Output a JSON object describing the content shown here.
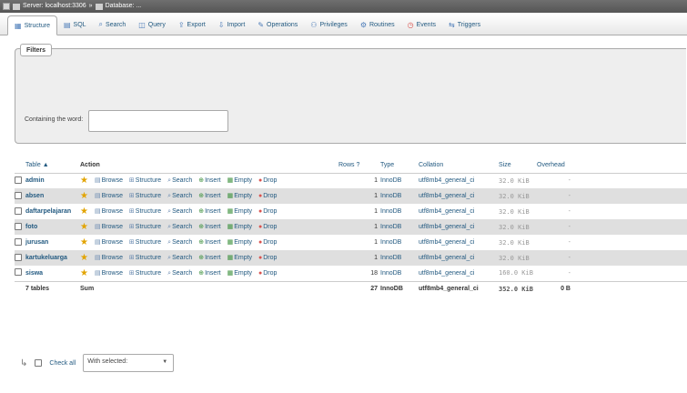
{
  "breadcrumb": {
    "server": "Server: localhost:3306",
    "database": "Database: ..."
  },
  "tabs": [
    {
      "label": "Structure",
      "icon": "structure-icon",
      "active": true
    },
    {
      "label": "SQL",
      "icon": "sql-icon"
    },
    {
      "label": "Search",
      "icon": "search-icon"
    },
    {
      "label": "Query",
      "icon": "query-icon"
    },
    {
      "label": "Export",
      "icon": "export-icon"
    },
    {
      "label": "Import",
      "icon": "import-icon"
    },
    {
      "label": "Operations",
      "icon": "wrench-icon"
    },
    {
      "label": "Privileges",
      "icon": "privileges-icon"
    },
    {
      "label": "Routines",
      "icon": "routines-icon"
    },
    {
      "label": "Events",
      "icon": "events-icon"
    },
    {
      "label": "Triggers",
      "icon": "triggers-icon"
    }
  ],
  "filters": {
    "legend": "Filters",
    "contains_label": "Containing the word:",
    "contains_value": ""
  },
  "table": {
    "headers": {
      "table": "Table",
      "action": "Action",
      "rows": "Rows",
      "type": "Type",
      "collation": "Collation",
      "size": "Size",
      "overhead": "Overhead"
    },
    "actions": [
      "Browse",
      "Structure",
      "Search",
      "Insert",
      "Empty",
      "Drop"
    ],
    "rows": [
      {
        "name": "admin",
        "rows": "1",
        "type": "InnoDB",
        "collation": "utf8mb4_general_ci",
        "size": "32.0 KiB",
        "overhead": "-"
      },
      {
        "name": "absen",
        "rows": "1",
        "type": "InnoDB",
        "collation": "utf8mb4_general_ci",
        "size": "32.0 KiB",
        "overhead": "-"
      },
      {
        "name": "daftarpelajaran",
        "rows": "1",
        "type": "InnoDB",
        "collation": "utf8mb4_general_ci",
        "size": "32.0 KiB",
        "overhead": "-"
      },
      {
        "name": "foto",
        "rows": "1",
        "type": "InnoDB",
        "collation": "utf8mb4_general_ci",
        "size": "32.0 KiB",
        "overhead": "-"
      },
      {
        "name": "jurusan",
        "rows": "1",
        "type": "InnoDB",
        "collation": "utf8mb4_general_ci",
        "size": "32.0 KiB",
        "overhead": "-"
      },
      {
        "name": "kartukeluarga",
        "rows": "1",
        "type": "InnoDB",
        "collation": "utf8mb4_general_ci",
        "size": "32.0 KiB",
        "overhead": "-"
      },
      {
        "name": "siswa",
        "rows": "18",
        "type": "InnoDB",
        "collation": "utf8mb4_general_ci",
        "size": "160.0 KiB",
        "overhead": "-"
      }
    ],
    "footer": {
      "tables": "7 tables",
      "sum": "Sum",
      "rows": "27",
      "type": "InnoDB",
      "collation": "utf8mb4_general_ci",
      "size": "352.0 KiB",
      "overhead": "0 B"
    }
  },
  "bottom": {
    "check_all": "Check all",
    "with_selected": "With selected:"
  }
}
